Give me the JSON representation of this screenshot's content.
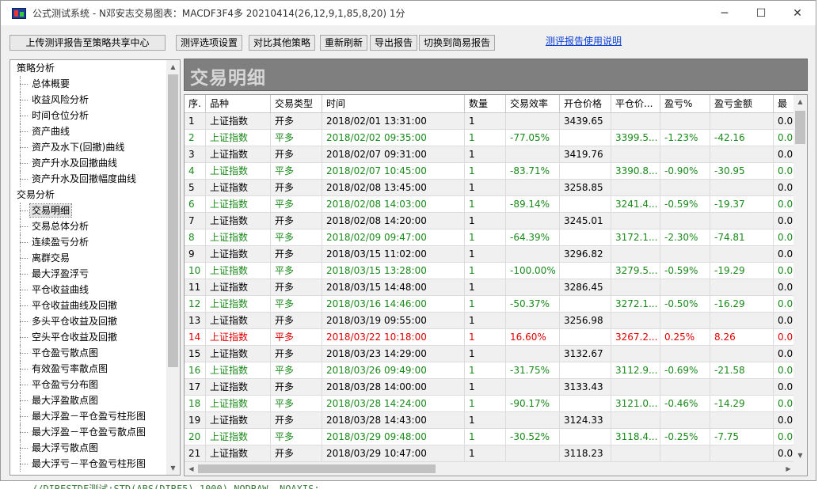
{
  "window": {
    "title": "公式测试系统 - N邓安志交易图表：MACDF3F4多 20210414(26,12,9,1,85,8,20) 1分",
    "minimize": "─",
    "maximize": "☐",
    "close": "✕"
  },
  "toolbar": {
    "upload": "上传测评报告至策略共享中心",
    "options": "测评选项设置",
    "compare": "对比其他策略",
    "refresh": "重新刷新",
    "export": "导出报告",
    "switch": "切换到简易报告",
    "help_link": "测评报告使用说明"
  },
  "sidebar": {
    "categories": [
      {
        "label": "策略分析",
        "items": [
          "总体概要",
          "收益风险分析",
          "时间仓位分析",
          "资产曲线",
          "资产及水下(回撤)曲线",
          "资产升水及回撤曲线",
          "资产升水及回撤幅度曲线"
        ]
      },
      {
        "label": "交易分析",
        "items": [
          "交易明细",
          "交易总体分析",
          "连续盈亏分析",
          "离群交易",
          "最大浮盈浮亏",
          "平仓收益曲线",
          "平仓收益曲线及回撤",
          "多头平仓收益及回撤",
          "空头平仓收益及回撤",
          "平仓盈亏散点图",
          "有效盈亏率散点图",
          "平仓盈亏分布图",
          "最大浮盈散点图",
          "最大浮盈－平仓盈亏柱形图",
          "最大浮盈－平仓盈亏散点图",
          "最大浮亏散点图",
          "最大浮亏－平仓盈亏柱形图"
        ]
      }
    ],
    "selected": "交易明细"
  },
  "main": {
    "header": "交易明细",
    "columns": [
      "序.",
      "品种",
      "交易类型",
      "时间",
      "数量",
      "交易效率",
      "开仓价格",
      "平仓价...",
      "盈亏%",
      "盈亏金额",
      "最"
    ],
    "rows": [
      {
        "no": "1",
        "symbol": "上证指数",
        "type": "开多",
        "time": "2018/02/01 13:31:00",
        "qty": "1",
        "eff": "",
        "open": "3439.65",
        "close": "",
        "pct": "",
        "amt": "",
        "extra": "0.0",
        "tone": "black"
      },
      {
        "no": "2",
        "symbol": "上证指数",
        "type": "平多",
        "time": "2018/02/02 09:35:00",
        "qty": "1",
        "eff": "-77.05%",
        "open": "",
        "close": "3399.5...",
        "pct": "-1.23%",
        "amt": "-42.16",
        "extra": "0.0",
        "tone": "green"
      },
      {
        "no": "3",
        "symbol": "上证指数",
        "type": "开多",
        "time": "2018/02/07 09:31:00",
        "qty": "1",
        "eff": "",
        "open": "3419.76",
        "close": "",
        "pct": "",
        "amt": "",
        "extra": "0.0",
        "tone": "black"
      },
      {
        "no": "4",
        "symbol": "上证指数",
        "type": "平多",
        "time": "2018/02/07 10:45:00",
        "qty": "1",
        "eff": "-83.71%",
        "open": "",
        "close": "3390.8...",
        "pct": "-0.90%",
        "amt": "-30.95",
        "extra": "0.0",
        "tone": "green"
      },
      {
        "no": "5",
        "symbol": "上证指数",
        "type": "开多",
        "time": "2018/02/08 13:45:00",
        "qty": "1",
        "eff": "",
        "open": "3258.85",
        "close": "",
        "pct": "",
        "amt": "",
        "extra": "0.0",
        "tone": "black"
      },
      {
        "no": "6",
        "symbol": "上证指数",
        "type": "平多",
        "time": "2018/02/08 14:03:00",
        "qty": "1",
        "eff": "-89.14%",
        "open": "",
        "close": "3241.4...",
        "pct": "-0.59%",
        "amt": "-19.37",
        "extra": "0.0",
        "tone": "green"
      },
      {
        "no": "7",
        "symbol": "上证指数",
        "type": "开多",
        "time": "2018/02/08 14:20:00",
        "qty": "1",
        "eff": "",
        "open": "3245.01",
        "close": "",
        "pct": "",
        "amt": "",
        "extra": "0.0",
        "tone": "black"
      },
      {
        "no": "8",
        "symbol": "上证指数",
        "type": "平多",
        "time": "2018/02/09 09:47:00",
        "qty": "1",
        "eff": "-64.39%",
        "open": "",
        "close": "3172.1...",
        "pct": "-2.30%",
        "amt": "-74.81",
        "extra": "0.0",
        "tone": "green"
      },
      {
        "no": "9",
        "symbol": "上证指数",
        "type": "开多",
        "time": "2018/03/15 11:02:00",
        "qty": "1",
        "eff": "",
        "open": "3296.82",
        "close": "",
        "pct": "",
        "amt": "",
        "extra": "0.0",
        "tone": "black"
      },
      {
        "no": "10",
        "symbol": "上证指数",
        "type": "平多",
        "time": "2018/03/15 13:28:00",
        "qty": "1",
        "eff": "-100.00%",
        "open": "",
        "close": "3279.5...",
        "pct": "-0.59%",
        "amt": "-19.29",
        "extra": "0.0",
        "tone": "green"
      },
      {
        "no": "11",
        "symbol": "上证指数",
        "type": "开多",
        "time": "2018/03/15 14:48:00",
        "qty": "1",
        "eff": "",
        "open": "3286.45",
        "close": "",
        "pct": "",
        "amt": "",
        "extra": "0.0",
        "tone": "black"
      },
      {
        "no": "12",
        "symbol": "上证指数",
        "type": "平多",
        "time": "2018/03/16 14:46:00",
        "qty": "1",
        "eff": "-50.37%",
        "open": "",
        "close": "3272.1...",
        "pct": "-0.50%",
        "amt": "-16.29",
        "extra": "0.0",
        "tone": "green"
      },
      {
        "no": "13",
        "symbol": "上证指数",
        "type": "开多",
        "time": "2018/03/19 09:55:00",
        "qty": "1",
        "eff": "",
        "open": "3256.98",
        "close": "",
        "pct": "",
        "amt": "",
        "extra": "0.0",
        "tone": "black"
      },
      {
        "no": "14",
        "symbol": "上证指数",
        "type": "平多",
        "time": "2018/03/22 10:18:00",
        "qty": "1",
        "eff": "16.60%",
        "open": "",
        "close": "3267.2...",
        "pct": "0.25%",
        "amt": "8.26",
        "extra": "0.0",
        "tone": "red"
      },
      {
        "no": "15",
        "symbol": "上证指数",
        "type": "开多",
        "time": "2018/03/23 14:29:00",
        "qty": "1",
        "eff": "",
        "open": "3132.67",
        "close": "",
        "pct": "",
        "amt": "",
        "extra": "0.0",
        "tone": "black"
      },
      {
        "no": "16",
        "symbol": "上证指数",
        "type": "平多",
        "time": "2018/03/26 09:49:00",
        "qty": "1",
        "eff": "-31.75%",
        "open": "",
        "close": "3112.9...",
        "pct": "-0.69%",
        "amt": "-21.58",
        "extra": "0.0",
        "tone": "green"
      },
      {
        "no": "17",
        "symbol": "上证指数",
        "type": "开多",
        "time": "2018/03/28 14:00:00",
        "qty": "1",
        "eff": "",
        "open": "3133.43",
        "close": "",
        "pct": "",
        "amt": "",
        "extra": "0.0",
        "tone": "black"
      },
      {
        "no": "18",
        "symbol": "上证指数",
        "type": "平多",
        "time": "2018/03/28 14:24:00",
        "qty": "1",
        "eff": "-90.17%",
        "open": "",
        "close": "3121.0...",
        "pct": "-0.46%",
        "amt": "-14.29",
        "extra": "0.0",
        "tone": "green"
      },
      {
        "no": "19",
        "symbol": "上证指数",
        "type": "开多",
        "time": "2018/03/28 14:43:00",
        "qty": "1",
        "eff": "",
        "open": "3124.33",
        "close": "",
        "pct": "",
        "amt": "",
        "extra": "0.0",
        "tone": "black"
      },
      {
        "no": "20",
        "symbol": "上证指数",
        "type": "平多",
        "time": "2018/03/29 09:48:00",
        "qty": "1",
        "eff": "-30.52%",
        "open": "",
        "close": "3118.4...",
        "pct": "-0.25%",
        "amt": "-7.75",
        "extra": "0.0",
        "tone": "green"
      },
      {
        "no": "21",
        "symbol": "上证指数",
        "type": "开多",
        "time": "2018/03/29 10:47:00",
        "qty": "1",
        "eff": "",
        "open": "3118.23",
        "close": "",
        "pct": "",
        "amt": "",
        "extra": "0.0",
        "tone": "black"
      }
    ]
  },
  "code_strip": "//DIRESTDF测试:STD(ABS(DIRF5),1000),NODRAW, NOAXIS;",
  "colors": {
    "profit_red": "#e00000",
    "loss_green": "#1a8a1a",
    "header_gray": "#7f7f7f",
    "link_blue": "#0b3fd6"
  }
}
